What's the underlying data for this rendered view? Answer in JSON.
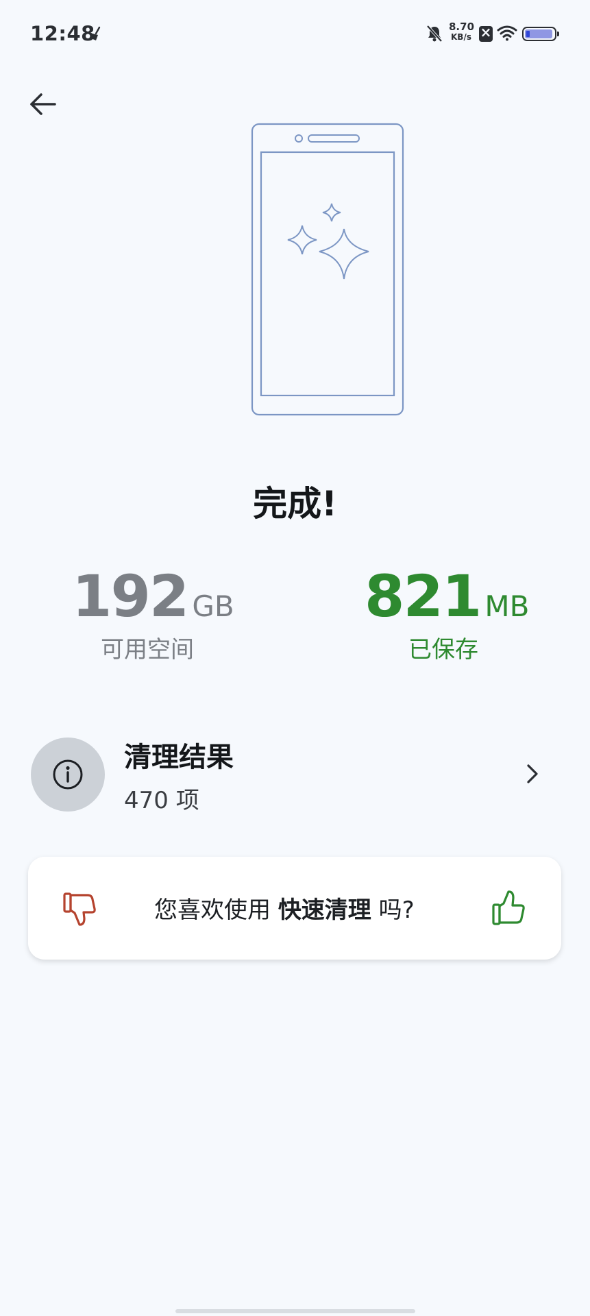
{
  "status_bar": {
    "time": "12:48",
    "net_speed_value": "8.70",
    "net_speed_unit": "KB/s",
    "icons": [
      "broom-icon",
      "bell-off-icon",
      "close-box-icon",
      "wifi-icon",
      "battery-icon"
    ]
  },
  "nav": {
    "back_icon": "arrow-left-icon"
  },
  "illustration": {
    "icon": "phone-sparkle-icon"
  },
  "title": "完成!",
  "stats": {
    "available": {
      "value": "192",
      "unit": "GB",
      "label": "可用空间"
    },
    "saved": {
      "value": "821",
      "unit": "MB",
      "label": "已保存"
    }
  },
  "result": {
    "icon": "info-icon",
    "title": "清理结果",
    "count": "470 项",
    "chevron": "chevron-right-icon"
  },
  "feedback": {
    "question_prefix": "您喜欢使用",
    "question_feature": "快速清理",
    "question_suffix": "吗?",
    "dislike_icon": "thumb-down-icon",
    "like_icon": "thumb-up-icon"
  },
  "colors": {
    "background": "#f6f9fd",
    "saved_green": "#2e8a30",
    "available_gray": "#7b7f85",
    "dislike_red": "#b5432e",
    "like_green": "#2e8a30",
    "illustration_blue": "#7c96c4"
  }
}
